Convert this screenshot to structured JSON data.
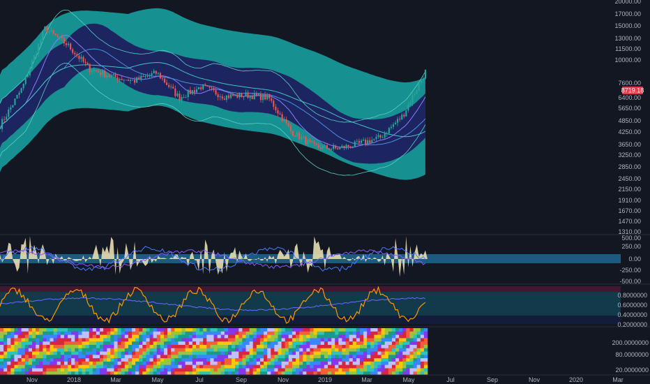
{
  "colors": {
    "background": "#131722",
    "band_outer": "#19a6a6",
    "band_inner": "#1e1a5c",
    "candle_up": "#26a69a",
    "candle_down": "#ef5350",
    "price_tag": "#e23d4c",
    "oscillator_line": "#ff9800",
    "volume_fill": "#e8dcb0"
  },
  "current_price": "8719.18",
  "chart_data": [
    {
      "type": "line",
      "panel": "price",
      "scale": "log",
      "ylim": [
        1310,
        20000
      ],
      "y_ticks": [
        "20000.00",
        "17000.00",
        "15000.00",
        "13000.00",
        "11500.00",
        "10000.00",
        "8719.18",
        "7600.00",
        "6400.00",
        "5650.00",
        "4850.00",
        "4250.00",
        "3650.00",
        "3250.00",
        "2850.00",
        "2450.00",
        "2150.00",
        "1910.00",
        "1670.00",
        "1470.00",
        "1310.00"
      ],
      "series": [
        {
          "x": [
            "2017-10",
            "2017-11",
            "2017-12",
            "2018-01",
            "2018-02",
            "2018-03",
            "2018-04",
            "2018-05",
            "2018-06",
            "2018-07",
            "2018-08",
            "2018-09",
            "2018-10",
            "2018-11",
            "2018-12",
            "2019-01",
            "2019-02",
            "2019-03",
            "2019-04",
            "2019-05"
          ],
          "values": [
            4600,
            7200,
            14500,
            12000,
            9000,
            8200,
            7800,
            8600,
            6400,
            7300,
            6500,
            6600,
            6400,
            4300,
            3600,
            3500,
            3700,
            4000,
            5200,
            8719.18
          ]
        }
      ]
    },
    {
      "type": "area",
      "panel": "volume-oscillator",
      "y_ticks": [
        "500.00",
        "250.00",
        "0.00",
        "-250.00",
        "-500.00"
      ],
      "ylim": [
        -500,
        500
      ]
    },
    {
      "type": "line",
      "panel": "oscillator",
      "y_ticks": [
        "0.8000000",
        "0.6000000",
        "0.4000000",
        "0.2000000"
      ],
      "ylim": [
        0.2,
        1.0
      ]
    },
    {
      "type": "heatmap",
      "panel": "cycle-heatmap",
      "y_ticks": [
        "200.0000000",
        "80.0000000",
        "20.0000000"
      ]
    }
  ],
  "time_axis": [
    "Nov",
    "2018",
    "Mar",
    "May",
    "Jul",
    "Sep",
    "Nov",
    "2019",
    "Mar",
    "May",
    "Jul",
    "Sep",
    "Nov",
    "2020",
    "Mar"
  ]
}
